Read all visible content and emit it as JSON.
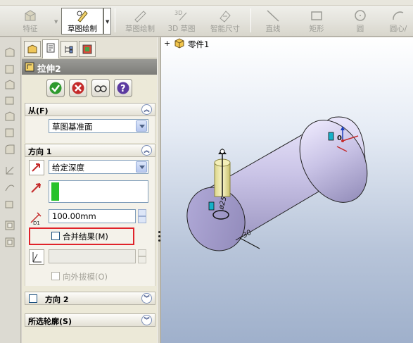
{
  "toolbar": {
    "feature_label": "特征",
    "sketch_label": "草图绘制",
    "sketch2_label": "草图绘制",
    "sketch3d_label": "3D 草图",
    "smartdim_label": "智能尺寸",
    "line_label": "直线",
    "rect_label": "矩形",
    "circle_label": "圆",
    "circle2_label": "圆心/"
  },
  "pm_tabs": [
    "feature-manager-tab",
    "property-manager-tab",
    "configuration-manager-tab",
    "display-manager-tab"
  ],
  "property_manager": {
    "title": "拉伸2",
    "from_group": {
      "label": "从(F)",
      "start_condition": "草图基准面"
    },
    "direction1_group": {
      "label": "方向 1",
      "end_condition": "给定深度",
      "depth_value": "100.00mm",
      "merge_result_label": "合并结果(M)",
      "merge_result_checked": false,
      "draft_outward_label": "向外拔模(O)",
      "draft_outward_checked": false
    },
    "direction2_group": {
      "label": "方向 2",
      "checked": false
    },
    "contours_group": {
      "label": "所选轮廓(S)"
    }
  },
  "viewport": {
    "tree_root_label": "零件1",
    "expand_symbol": "+",
    "dim_diameter": "ø25",
    "dim_length": "30",
    "dim_origin": "0"
  },
  "colors": {
    "highlight_red": "#e0232a",
    "confirm_green": "#2e9a2e",
    "cancel_red": "#c42a2a",
    "help_purple": "#5b3aa0",
    "selection_green": "#27c22b",
    "part_fill": "#c9c3e6"
  }
}
